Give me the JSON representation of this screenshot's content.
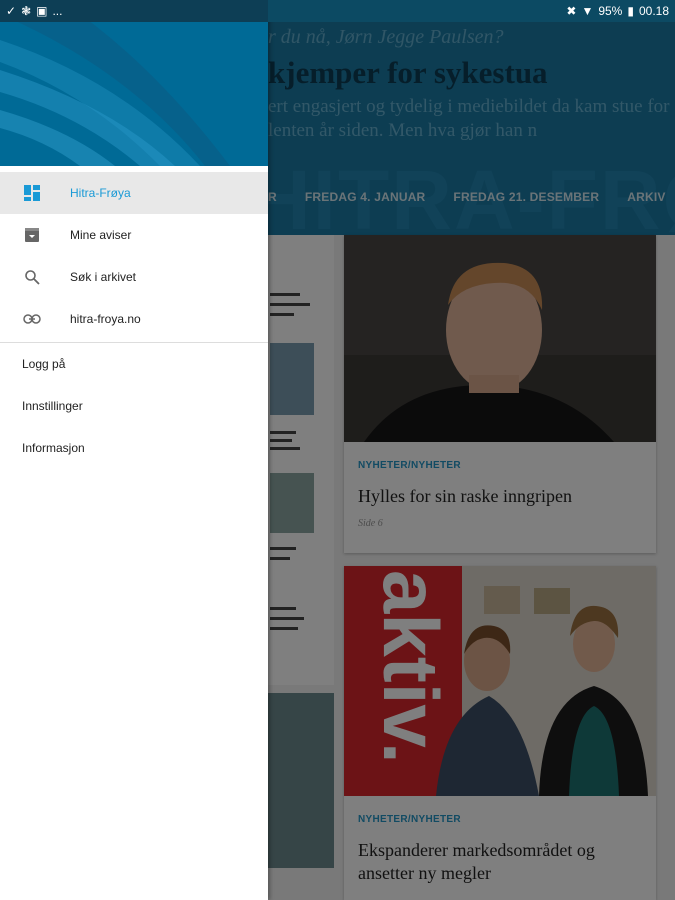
{
  "status_bar": {
    "left_icons": [
      "check-icon",
      "fan-icon",
      "image-icon",
      "more-icon"
    ],
    "more_text": "...",
    "battery": "95%",
    "time": "00.18"
  },
  "hero": {
    "kicker": "r du nå, Jørn Jegge Paulsen?",
    "headline": "kjemper for sykestua",
    "ingress": "ert engasjert og tydelig i mediebildet da kam stue for lenten år siden. Men hva gjør han n",
    "logo": "HITRA-FRØ"
  },
  "tabs": [
    "R",
    "FREDAG 4. JANUAR",
    "FREDAG 21. DESEMBER",
    "ARKIV"
  ],
  "cards": [
    {
      "section": "NYHETER/NYHETER",
      "title": "Hylles for sin raske inngripen",
      "page": "Side 6"
    },
    {
      "section": "NYHETER/NYHETER",
      "title": "Ekspanderer markedsområdet og ansetter ny megler",
      "photo_text": "aktiv."
    }
  ],
  "drawer": {
    "nav": [
      {
        "label": "Hitra-Frøya",
        "icon": "grid-icon",
        "active": true
      },
      {
        "label": "Mine aviser",
        "icon": "archive-box-icon",
        "active": false
      },
      {
        "label": "Søk i arkivet",
        "icon": "search-icon",
        "active": false
      },
      {
        "label": "hitra-froya.no",
        "icon": "link-icon",
        "active": false
      }
    ],
    "secondary": [
      "Logg på",
      "Innstillinger",
      "Informasjon"
    ]
  },
  "colors": {
    "accent": "#1a9ad6",
    "header": "#006a96",
    "section": "#2496c7"
  }
}
